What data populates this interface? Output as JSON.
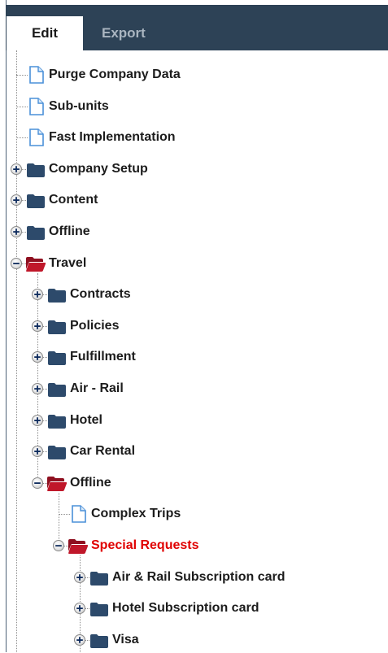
{
  "tabs": [
    {
      "label": "Edit",
      "active": true
    },
    {
      "label": "Export",
      "active": false
    }
  ],
  "tree": {
    "items": [
      {
        "label": "Purge Company Data",
        "icon": "document-icon"
      },
      {
        "label": "Sub-units",
        "icon": "document-icon"
      },
      {
        "label": "Fast Implementation",
        "icon": "document-icon"
      },
      {
        "label": "Company Setup",
        "icon": "folder-icon",
        "state": "collapsed"
      },
      {
        "label": "Content",
        "icon": "folder-icon",
        "state": "collapsed"
      },
      {
        "label": "Offline",
        "icon": "folder-icon",
        "state": "collapsed"
      },
      {
        "label": "Travel",
        "icon": "folder-open-icon",
        "state": "expanded"
      },
      {
        "label": "Contracts",
        "icon": "folder-icon",
        "state": "collapsed"
      },
      {
        "label": "Policies",
        "icon": "folder-icon",
        "state": "collapsed"
      },
      {
        "label": "Fulfillment",
        "icon": "folder-icon",
        "state": "collapsed"
      },
      {
        "label": "Air - Rail",
        "icon": "folder-icon",
        "state": "collapsed"
      },
      {
        "label": "Hotel",
        "icon": "folder-icon",
        "state": "collapsed"
      },
      {
        "label": "Car Rental",
        "icon": "folder-icon",
        "state": "collapsed"
      },
      {
        "label": "Offline",
        "icon": "folder-open-icon",
        "state": "expanded"
      },
      {
        "label": "Complex Trips",
        "icon": "document-icon"
      },
      {
        "label": "Special Requests",
        "icon": "folder-open-icon",
        "state": "expanded",
        "selected": true
      },
      {
        "label": "Air & Rail Subscription card",
        "icon": "folder-icon",
        "state": "collapsed"
      },
      {
        "label": "Hotel Subscription card",
        "icon": "folder-icon",
        "state": "collapsed"
      },
      {
        "label": "Visa",
        "icon": "folder-icon",
        "state": "collapsed"
      }
    ]
  },
  "colors": {
    "header": "#2d4256",
    "folder": "#2d4a6b",
    "folder_open": "#c0172a",
    "selected_text": "#e00000",
    "document": "#4a90d9"
  }
}
